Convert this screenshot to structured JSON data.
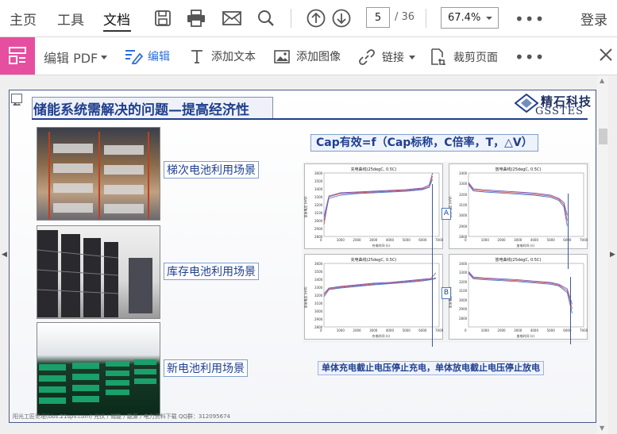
{
  "menu": {
    "home": "主页",
    "tools": "工具",
    "document": "文档",
    "login": "登录"
  },
  "nav": {
    "current_page": "5",
    "total_pages": "/ 36",
    "zoom": "67.4%"
  },
  "toolbar": {
    "edit_pdf": "编辑 PDF",
    "edit": "编辑",
    "add_text": "添加文本",
    "add_image": "添加图像",
    "link": "链接",
    "crop": "裁剪页面"
  },
  "slide": {
    "title": "储能系统需解决的问题—提高经济性",
    "logo_cn": "精石科技",
    "logo_en": "GSSTES",
    "formula": "Cap有效=f（Cap标称，C倍率，T，△V）",
    "photo_labels": [
      "梯次电池利用场景",
      "库存电池利用场景",
      "新电池利用场景"
    ],
    "bottom_note": "单体充电截止电压停止充电，单体放电截止电压停止放电",
    "footer": "阳光工匠论坛(bbs.21spv.com)      光伏 / 储能 / 能源 / 电力资料下载      QQ群：312095674",
    "markers": [
      "A",
      "B"
    ],
    "chart_titles": [
      "充电曲线(25degC, 0.5C)",
      "放电曲线(25degC, 0.5C)",
      "充电曲线(25degC, 0.5C)",
      "放电曲线(25degC, 0.5C)"
    ],
    "chart_xlabels": [
      "充电时间 (s)",
      "放电时间 (s)",
      "充电时间 (s)",
      "放电时间 (s)"
    ],
    "chart_ylabels": [
      "单体电压 (mV)",
      "单体电压 (mV)",
      "单体电压 (mV)",
      "单体电压 (mV)"
    ],
    "x_ticks": [
      "0",
      "1000",
      "2000",
      "3000",
      "4000",
      "5000",
      "6000",
      "7000"
    ],
    "y_ticks": [
      [
        "3600",
        "3500",
        "3400",
        "3300",
        "3200",
        "3100",
        "3000",
        "2900",
        "2800"
      ],
      [
        "3400",
        "3300",
        "3200",
        "3100",
        "3000",
        "2900",
        "2800"
      ],
      [
        "3600",
        "3500",
        "3400",
        "3300",
        "3200",
        "3100",
        "3000",
        "2900",
        "2800"
      ],
      [
        "3400",
        "3300",
        "3200",
        "3100",
        "3000",
        "2900",
        "2800"
      ]
    ]
  },
  "colors": {
    "accent_pink": "#e64ea0",
    "slide_title": "#1f3f8f",
    "icon": "#555555"
  },
  "chart_data": [
    {
      "type": "line",
      "title": "充电曲线(25degC, 0.5C)",
      "xlabel": "充电时间 (s)",
      "ylabel": "单体电压 (mV)",
      "xlim": [
        0,
        7000
      ],
      "ylim": [
        2800,
        3600
      ],
      "x": [
        0,
        300,
        1000,
        2000,
        3000,
        4000,
        5000,
        6000,
        6400,
        6600
      ],
      "series": [
        {
          "values": [
            2950,
            3300,
            3340,
            3350,
            3360,
            3370,
            3380,
            3400,
            3430,
            3560
          ]
        },
        {
          "values": [
            3000,
            3280,
            3320,
            3340,
            3350,
            3360,
            3370,
            3390,
            3420,
            3520
          ]
        },
        {
          "values": [
            3050,
            3310,
            3350,
            3360,
            3370,
            3380,
            3390,
            3410,
            3450,
            3600
          ]
        }
      ]
    },
    {
      "type": "line",
      "title": "放电曲线(25degC, 0.5C)",
      "xlabel": "放电时间 (s)",
      "ylabel": "单体电压 (mV)",
      "xlim": [
        0,
        7000
      ],
      "ylim": [
        2800,
        3400
      ],
      "x": [
        0,
        300,
        1000,
        2000,
        3000,
        4000,
        5000,
        5500,
        5800,
        6000
      ],
      "series": [
        {
          "values": [
            3300,
            3240,
            3230,
            3220,
            3210,
            3200,
            3180,
            3150,
            3100,
            2950
          ]
        },
        {
          "values": [
            3290,
            3230,
            3220,
            3210,
            3200,
            3190,
            3170,
            3140,
            3080,
            2900
          ]
        },
        {
          "values": [
            3310,
            3250,
            3240,
            3230,
            3220,
            3210,
            3190,
            3160,
            3120,
            3000
          ]
        }
      ]
    },
    {
      "type": "line",
      "title": "充电曲线(25degC, 0.5C)",
      "xlabel": "充电时间 (s)",
      "ylabel": "单体电压 (mV)",
      "xlim": [
        0,
        7000
      ],
      "ylim": [
        2800,
        3600
      ],
      "x": [
        0,
        300,
        1000,
        2000,
        3000,
        4000,
        5000,
        6000,
        6500,
        6800
      ],
      "series": [
        {
          "values": [
            3200,
            3280,
            3300,
            3320,
            3340,
            3350,
            3370,
            3390,
            3400,
            3420
          ]
        },
        {
          "values": [
            3180,
            3270,
            3290,
            3310,
            3330,
            3345,
            3360,
            3380,
            3395,
            3410
          ]
        },
        {
          "values": [
            3220,
            3290,
            3310,
            3330,
            3350,
            3360,
            3380,
            3400,
            3410,
            3480
          ]
        }
      ]
    },
    {
      "type": "line",
      "title": "放电曲线(25degC, 0.5C)",
      "xlabel": "放电时间 (s)",
      "ylabel": "单体电压 (mV)",
      "xlim": [
        0,
        7000
      ],
      "ylim": [
        2700,
        3400
      ],
      "x": [
        0,
        300,
        1000,
        2000,
        3000,
        4000,
        5000,
        5500,
        6000,
        6300
      ],
      "series": [
        {
          "values": [
            3300,
            3240,
            3230,
            3220,
            3210,
            3195,
            3180,
            3160,
            3100,
            2900
          ]
        },
        {
          "values": [
            3290,
            3230,
            3220,
            3210,
            3200,
            3185,
            3170,
            3150,
            3080,
            2850
          ]
        },
        {
          "values": [
            3310,
            3250,
            3240,
            3230,
            3220,
            3205,
            3190,
            3170,
            3120,
            2950
          ]
        }
      ]
    }
  ]
}
